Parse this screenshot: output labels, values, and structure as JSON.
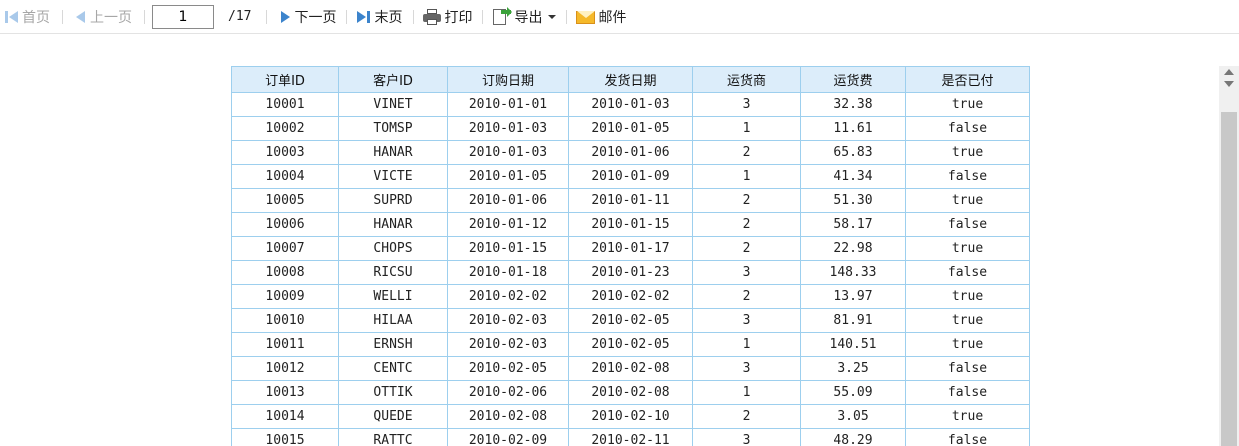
{
  "toolbar": {
    "first_label": "首页",
    "prev_label": "上一页",
    "page_current": "1",
    "page_total": "/17",
    "next_label": "下一页",
    "last_label": "末页",
    "print_label": "打印",
    "export_label": "导出",
    "mail_label": "邮件"
  },
  "table": {
    "columns": [
      "订单ID",
      "客户ID",
      "订购日期",
      "发货日期",
      "运货商",
      "运货费",
      "是否已付"
    ],
    "rows": [
      [
        "10001",
        "VINET",
        "2010-01-01",
        "2010-01-03",
        "3",
        "32.38",
        "true"
      ],
      [
        "10002",
        "TOMSP",
        "2010-01-03",
        "2010-01-05",
        "1",
        "11.61",
        "false"
      ],
      [
        "10003",
        "HANAR",
        "2010-01-03",
        "2010-01-06",
        "2",
        "65.83",
        "true"
      ],
      [
        "10004",
        "VICTE",
        "2010-01-05",
        "2010-01-09",
        "1",
        "41.34",
        "false"
      ],
      [
        "10005",
        "SUPRD",
        "2010-01-06",
        "2010-01-11",
        "2",
        "51.30",
        "true"
      ],
      [
        "10006",
        "HANAR",
        "2010-01-12",
        "2010-01-15",
        "2",
        "58.17",
        "false"
      ],
      [
        "10007",
        "CHOPS",
        "2010-01-15",
        "2010-01-17",
        "2",
        "22.98",
        "true"
      ],
      [
        "10008",
        "RICSU",
        "2010-01-18",
        "2010-01-23",
        "3",
        "148.33",
        "false"
      ],
      [
        "10009",
        "WELLI",
        "2010-02-02",
        "2010-02-02",
        "2",
        "13.97",
        "true"
      ],
      [
        "10010",
        "HILAA",
        "2010-02-03",
        "2010-02-05",
        "3",
        "81.91",
        "true"
      ],
      [
        "10011",
        "ERNSH",
        "2010-02-03",
        "2010-02-05",
        "1",
        "140.51",
        "true"
      ],
      [
        "10012",
        "CENTC",
        "2010-02-05",
        "2010-02-08",
        "3",
        "3.25",
        "false"
      ],
      [
        "10013",
        "OTTIK",
        "2010-02-06",
        "2010-02-08",
        "1",
        "55.09",
        "false"
      ],
      [
        "10014",
        "QUEDE",
        "2010-02-08",
        "2010-02-10",
        "2",
        "3.05",
        "true"
      ],
      [
        "10015",
        "RATTC",
        "2010-02-09",
        "2010-02-11",
        "3",
        "48.29",
        "false"
      ]
    ]
  },
  "icons": {
    "first": "first-page-icon",
    "prev": "previous-page-icon",
    "next": "next-page-icon",
    "last": "last-page-icon",
    "print": "printer-icon",
    "export": "export-icon",
    "mail": "mail-icon"
  }
}
